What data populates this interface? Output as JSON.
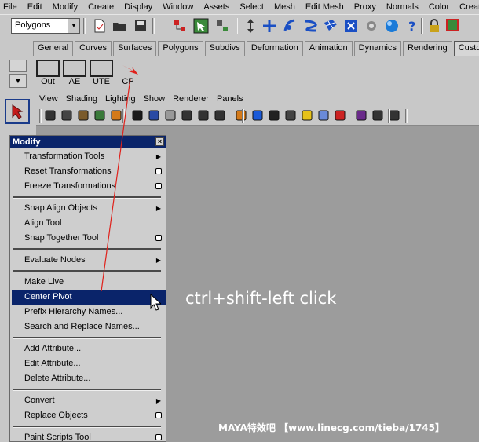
{
  "menubar": {
    "items": [
      "File",
      "Edit",
      "Modify",
      "Create",
      "Display",
      "Window",
      "Assets",
      "Select",
      "Mesh",
      "Edit Mesh",
      "Proxy",
      "Normals",
      "Color",
      "Create UV"
    ]
  },
  "statusline": {
    "mode_value": "Polygons"
  },
  "shelf": {
    "tabs": [
      "General",
      "Curves",
      "Surfaces",
      "Polygons",
      "Subdivs",
      "Deformation",
      "Animation",
      "Dynamics",
      "Rendering",
      "Custom"
    ],
    "active_tab": "Custom",
    "buttons": [
      "Out",
      "AE",
      "UTE",
      "CP"
    ]
  },
  "panel": {
    "menu": [
      "View",
      "Shading",
      "Lighting",
      "Show",
      "Renderer",
      "Panels"
    ]
  },
  "modify_menu": {
    "title": "Modify",
    "close": "×",
    "items": [
      {
        "label": "Transformation Tools",
        "kind": "submenu"
      },
      {
        "label": "Reset Transformations",
        "kind": "option"
      },
      {
        "label": "Freeze Transformations",
        "kind": "option"
      },
      {
        "label": "Snap Align Objects",
        "kind": "submenu"
      },
      {
        "label": "Align Tool",
        "kind": "plain"
      },
      {
        "label": "Snap Together Tool",
        "kind": "option"
      },
      {
        "label": "Evaluate Nodes",
        "kind": "submenu"
      },
      {
        "label": "Make Live",
        "kind": "plain"
      },
      {
        "label": "Center Pivot",
        "kind": "plain"
      },
      {
        "label": "Prefix Hierarchy Names...",
        "kind": "plain"
      },
      {
        "label": "Search and Replace Names...",
        "kind": "plain"
      },
      {
        "label": "Add Attribute...",
        "kind": "plain"
      },
      {
        "label": "Edit Attribute...",
        "kind": "plain"
      },
      {
        "label": "Delete Attribute...",
        "kind": "plain"
      },
      {
        "label": "Convert",
        "kind": "submenu"
      },
      {
        "label": "Replace Objects",
        "kind": "option"
      },
      {
        "label": "Paint Scripts Tool",
        "kind": "option"
      }
    ],
    "highlighted": "Center Pivot"
  },
  "annotation": {
    "caption": "ctrl+shift-left click",
    "watermark": "MAYA特效吧 【www.linecg.com/tieba/1745】"
  },
  "colors": {
    "ui_gray": "#c8c8c8",
    "viewport_gray": "#9c9c9c",
    "highlight_blue": "#0a246a",
    "annotation_red": "#e0201a"
  },
  "icons": {
    "status": [
      "new-scene-icon",
      "open-scene-icon",
      "save-scene-icon",
      "select-by-hierarchy-icon",
      "select-by-object-icon",
      "select-by-component-icon",
      "move-icon",
      "snap-curve-icon",
      "snap-point-icon",
      "snap-grid-icon",
      "render-icon",
      "help-icon",
      "lock-icon",
      "selection-lock-icon"
    ],
    "panel": [
      "camera-icon",
      "bookmark-icon",
      "image-plane-icon",
      "two-d-pan-icon",
      "wireframe-icon",
      "smooth-shade-icon",
      "texture-icon",
      "grid-icon",
      "resolution-gate-icon",
      "field-chart-icon",
      "isolate-select-icon",
      "cube-wire-icon",
      "cube-blue-icon",
      "cube-dark-icon",
      "lighting-icon",
      "shadow-icon",
      "xray-icon",
      "xray-joints-icon",
      "frame-selection-icon",
      "camera-attr-icon",
      "safe-action-icon"
    ]
  }
}
